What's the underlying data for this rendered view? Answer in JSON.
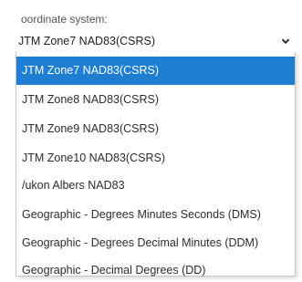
{
  "field": {
    "label": "oordinate system:",
    "value": "JTM Zone7 NAD83(CSRS)"
  },
  "icons": {
    "chevron": "chevron-down-icon"
  },
  "colors": {
    "selection": "#1e7fd2"
  },
  "dropdown": {
    "options": [
      {
        "label": "JTM Zone7 NAD83(CSRS)",
        "selected": true
      },
      {
        "label": "JTM Zone8 NAD83(CSRS)",
        "selected": false
      },
      {
        "label": "JTM Zone9 NAD83(CSRS)",
        "selected": false
      },
      {
        "label": "JTM Zone10 NAD83(CSRS)",
        "selected": false
      },
      {
        "label": "/ukon Albers NAD83",
        "selected": false
      },
      {
        "label": "Geographic - Degrees Minutes Seconds (DMS)",
        "selected": false
      },
      {
        "label": "Geographic - Degrees Decimal Minutes (DDM)",
        "selected": false
      },
      {
        "label": "Geographic - Decimal Degrees (DD)",
        "selected": false
      }
    ]
  }
}
